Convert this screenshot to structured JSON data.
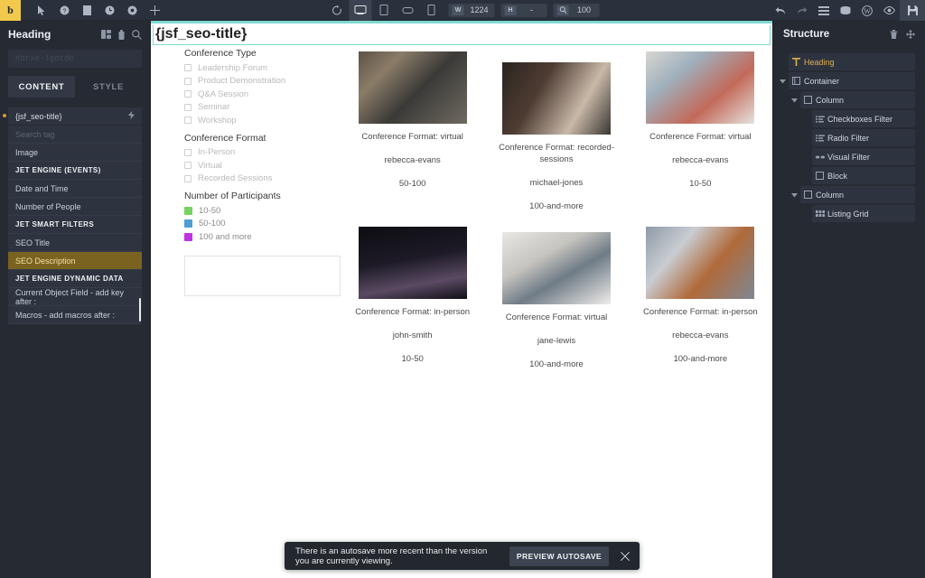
{
  "topbar": {
    "logo": "b",
    "left_icons": [
      "cursor-icon",
      "help-icon",
      "template-icon",
      "history-icon",
      "settings-icon",
      "add-icon"
    ],
    "reload_icon": "reload-icon",
    "devices": [
      {
        "name": "desktop",
        "active": true
      },
      {
        "name": "tablet",
        "active": false
      },
      {
        "name": "tablet-landscape",
        "active": false
      },
      {
        "name": "mobile",
        "active": false
      }
    ],
    "width_label": "W",
    "width_value": "1224",
    "height_label": "H",
    "height_value": "-",
    "zoom_label": "zoom-icon",
    "zoom_value": "100",
    "right_icons": [
      "undo-icon",
      "redo-icon",
      "menu-icon",
      "database-icon",
      "wordpress-icon",
      "preview-eye-icon"
    ],
    "save_icon": "save-icon"
  },
  "left_panel": {
    "title": "Heading",
    "head_icons": [
      "panel-layout-icon",
      "history-icon",
      "search-icon"
    ],
    "element_id_placeholder": "#brxe-lgotdb",
    "element_id_value": "",
    "tabs": [
      {
        "label": "CONTENT",
        "active": true
      },
      {
        "label": "STYLE",
        "active": false
      }
    ],
    "dynamic_trigger": {
      "label": "{jsf_seo-title}",
      "bolt_icon": "lightning-icon"
    },
    "dropdown": {
      "search_placeholder": "Search tag",
      "items": [
        {
          "label": "Image",
          "type": "item",
          "selected": false
        },
        {
          "label": "JET ENGINE (EVENTS)",
          "type": "group",
          "selected": false
        },
        {
          "label": "Date and Time",
          "type": "item",
          "selected": false
        },
        {
          "label": "Number of People",
          "type": "item",
          "selected": false
        },
        {
          "label": "JET SMART FILTERS",
          "type": "group",
          "selected": false
        },
        {
          "label": "SEO Title",
          "type": "item",
          "selected": false
        },
        {
          "label": "SEO Description",
          "type": "item",
          "selected": true
        },
        {
          "label": "JET ENGINE DYNAMIC DATA",
          "type": "group",
          "selected": false
        },
        {
          "label": "Current Object Field - add key after :",
          "type": "item",
          "selected": false
        },
        {
          "label": "Macros - add macros after :",
          "type": "item",
          "selected": false
        }
      ]
    }
  },
  "canvas": {
    "heading": "{jsf_seo-title}",
    "filters": [
      {
        "title": "Conference Type",
        "kind": "checkbox",
        "options": [
          "Leadership Forum",
          "Product Demonstration",
          "Q&A Session",
          "Seminar",
          "Workshop"
        ]
      },
      {
        "title": "Conference Format",
        "kind": "checkbox",
        "options": [
          "In-Person",
          "Virtual",
          "Recorded Sessions"
        ]
      },
      {
        "title": "Number of Participants",
        "kind": "swatch",
        "swatches": [
          {
            "label": "10-50",
            "color": "#76d35f"
          },
          {
            "label": "50-100",
            "color": "#4d9fd4"
          },
          {
            "label": "100 and more",
            "color": "#c232e0"
          }
        ]
      }
    ],
    "listing": [
      {
        "format": "Conference Format: virtual",
        "speaker": "rebecca-evans",
        "participants": "50-100"
      },
      {
        "format": "Conference Format: recorded-sessions",
        "speaker": "michael-jones",
        "participants": "100-and-more"
      },
      {
        "format": "Conference Format: virtual",
        "speaker": "rebecca-evans",
        "participants": "10-50"
      },
      {
        "format": "Conference Format: in-person",
        "speaker": "john-smith",
        "participants": "10-50"
      },
      {
        "format": "Conference Format: virtual",
        "speaker": "jane-lewis",
        "participants": "100-and-more"
      },
      {
        "format": "Conference Format: in-person",
        "speaker": "rebecca-evans",
        "participants": "100-and-more"
      }
    ]
  },
  "right_panel": {
    "title": "Structure",
    "head_icons": [
      "trash-icon",
      "move-icon"
    ],
    "tree": [
      {
        "label": "Heading",
        "icon": "text-icon",
        "depth": 0,
        "caret": "",
        "selected": true
      },
      {
        "label": "Container",
        "icon": "container-icon",
        "depth": 0,
        "caret": "down",
        "selected": false
      },
      {
        "label": "Column",
        "icon": "column-icon",
        "depth": 1,
        "caret": "down",
        "selected": false
      },
      {
        "label": "Checkboxes Filter",
        "icon": "list-icon",
        "depth": 2,
        "caret": "",
        "selected": false
      },
      {
        "label": "Radio Filter",
        "icon": "list-icon",
        "depth": 2,
        "caret": "",
        "selected": false
      },
      {
        "label": "Visual Filter",
        "icon": "visual-icon",
        "depth": 2,
        "caret": "",
        "selected": false
      },
      {
        "label": "Block",
        "icon": "column-icon",
        "depth": 2,
        "caret": "",
        "selected": false
      },
      {
        "label": "Column",
        "icon": "column-icon",
        "depth": 1,
        "caret": "down",
        "selected": false
      },
      {
        "label": "Listing Grid",
        "icon": "grid-icon",
        "depth": 2,
        "caret": "",
        "selected": false
      }
    ]
  },
  "notice": {
    "text": "There is an autosave more recent than the version you are currently viewing.",
    "button": "PREVIEW AUTOSAVE",
    "close_icon": "close-icon"
  },
  "colors": {
    "accent_yellow": "#f2c94c",
    "canvas_outline": "#7fd9d0",
    "panel_bg": "#252a33",
    "topbar_bg": "#2b313c",
    "selected_item": "#7a6321"
  }
}
